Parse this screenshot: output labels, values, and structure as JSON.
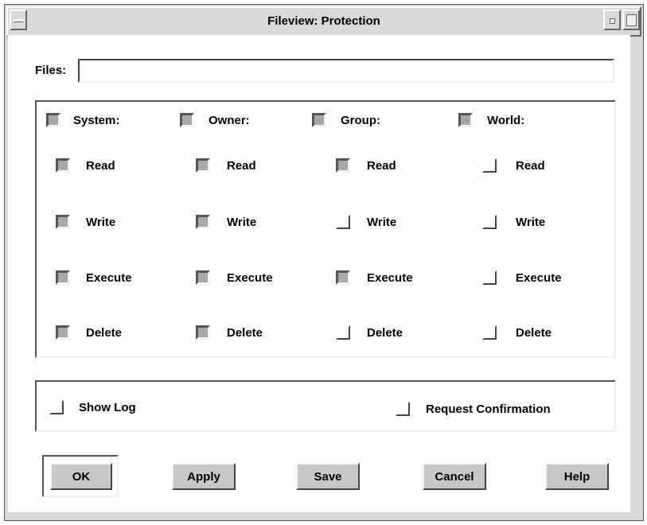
{
  "window": {
    "title": "Fileview: Protection"
  },
  "files": {
    "label": "Files:",
    "value": ""
  },
  "columns": [
    {
      "label": "System:",
      "checked": true,
      "perms": [
        {
          "label": "Read",
          "checked": true
        },
        {
          "label": "Write",
          "checked": true
        },
        {
          "label": "Execute",
          "checked": true
        },
        {
          "label": "Delete",
          "checked": true
        }
      ]
    },
    {
      "label": "Owner:",
      "checked": true,
      "perms": [
        {
          "label": "Read",
          "checked": true
        },
        {
          "label": "Write",
          "checked": true
        },
        {
          "label": "Execute",
          "checked": true
        },
        {
          "label": "Delete",
          "checked": true
        }
      ]
    },
    {
      "label": "Group:",
      "checked": true,
      "perms": [
        {
          "label": "Read",
          "checked": true
        },
        {
          "label": "Write",
          "checked": false
        },
        {
          "label": "Execute",
          "checked": true
        },
        {
          "label": "Delete",
          "checked": false
        }
      ]
    },
    {
      "label": "World:",
      "checked": true,
      "perms": [
        {
          "label": "Read",
          "checked": false
        },
        {
          "label": "Write",
          "checked": false
        },
        {
          "label": "Execute",
          "checked": false
        },
        {
          "label": "Delete",
          "checked": false
        }
      ]
    }
  ],
  "options": [
    {
      "label": "Show Log",
      "checked": false
    },
    {
      "label": "Request Confirmation",
      "checked": false
    }
  ],
  "buttons": [
    {
      "label": "OK",
      "name": "ok-button"
    },
    {
      "label": "Apply",
      "name": "apply-button"
    },
    {
      "label": "Save",
      "name": "save-button"
    },
    {
      "label": "Cancel",
      "name": "cancel-button"
    },
    {
      "label": "Help",
      "name": "help-button"
    }
  ],
  "colors": {
    "background": "#d9d9d9",
    "checked_fill": "#a8a8a8",
    "button": "#c8c8c8"
  },
  "icons": {
    "window_menu": "window-menu-icon",
    "minimize": "minimize-icon",
    "maximize": "maximize-icon"
  }
}
